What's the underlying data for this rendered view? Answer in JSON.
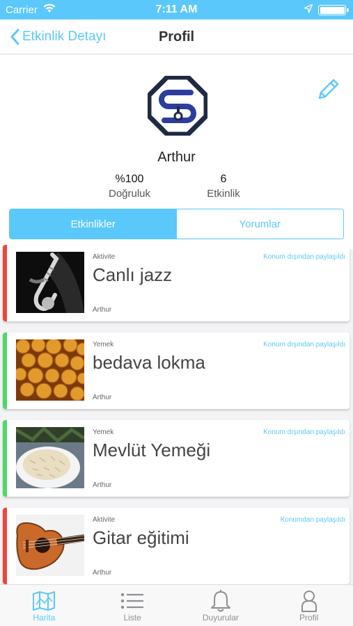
{
  "status_bar": {
    "carrier": "Carrier",
    "time": "7:11 AM",
    "battery_level": 1.0,
    "icons": [
      "wifi-icon",
      "location-arrow-icon",
      "battery-icon"
    ]
  },
  "nav": {
    "back_label": "Etkinlik Detayı",
    "title": "Profil"
  },
  "profile": {
    "name": "Arthur",
    "stats": [
      {
        "value": "%100",
        "label": "Doğruluk"
      },
      {
        "value": "6",
        "label": "Etkinlik"
      }
    ]
  },
  "tabs": [
    {
      "label": "Etkinlikler",
      "active": true
    },
    {
      "label": "Yorumlar",
      "active": false
    }
  ],
  "events": [
    {
      "category": "Aktivite",
      "title": "Canlı jazz",
      "author": "Arthur",
      "share": "Konum dışından paylaşıldı",
      "accent": "#f0453a",
      "image": "saxophone-image"
    },
    {
      "category": "Yemek",
      "title": "bedava lokma",
      "author": "Arthur",
      "share": "Konum dışından paylaşıldı",
      "accent": "#4cd964",
      "image": "lokma-image"
    },
    {
      "category": "Yemek",
      "title": "Mevlüt Yemeği",
      "author": "Arthur",
      "share": "Konum dışından paylaşıldı",
      "accent": "#4cd964",
      "image": "pilaf-image"
    },
    {
      "category": "Aktivite",
      "title": "Gitar eğitimi",
      "author": "Arthur",
      "share": "Konumdan paylaşıldı",
      "accent": "#f0453a",
      "image": "guitar-image"
    }
  ],
  "tab_bar": [
    {
      "label": "Harita",
      "icon": "map-icon",
      "active": true
    },
    {
      "label": "Liste",
      "icon": "list-icon",
      "active": false
    },
    {
      "label": "Duyurular",
      "icon": "bell-icon",
      "active": false
    },
    {
      "label": "Profil",
      "icon": "person-icon",
      "active": false
    }
  ],
  "colors": {
    "accent": "#5ac8fa",
    "activity": "#f0453a",
    "food": "#4cd964",
    "logo_dark": "#1f2a44",
    "logo_blue": "#2b3e9e"
  }
}
